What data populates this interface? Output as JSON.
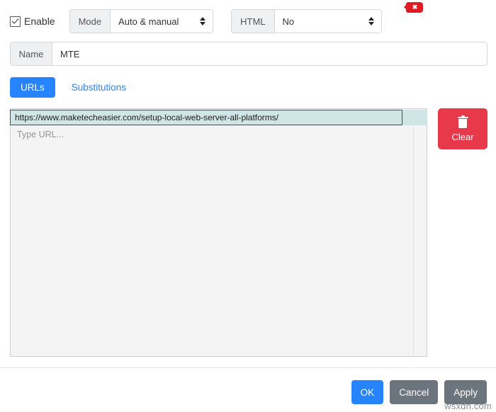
{
  "toolbar": {
    "enable_label": "Enable",
    "enable_checked": true,
    "mode_label": "Mode",
    "mode_value": "Auto & manual",
    "html_label": "HTML",
    "html_value": "No"
  },
  "name_row": {
    "label": "Name",
    "value": "MTE"
  },
  "tabs": {
    "urls": "URLs",
    "substitutions": "Substitutions"
  },
  "url_list": {
    "entries": [
      {
        "url": "https://www.maketecheasier.com/setup-local-web-server-all-platforms/",
        "delete_glyph": "✖"
      }
    ],
    "placeholder": "Type URL..."
  },
  "clear_button": {
    "label": "Clear"
  },
  "footer": {
    "ok": "OK",
    "cancel": "Cancel",
    "apply": "Apply"
  },
  "watermark": {
    "text": "wsxdn.com"
  },
  "colors": {
    "accent_blue": "#2684ff",
    "danger_red": "#e8394b",
    "delete_red": "#e01b24",
    "secondary_gray": "#6c757d",
    "row_highlight": "#cfe5e6"
  }
}
